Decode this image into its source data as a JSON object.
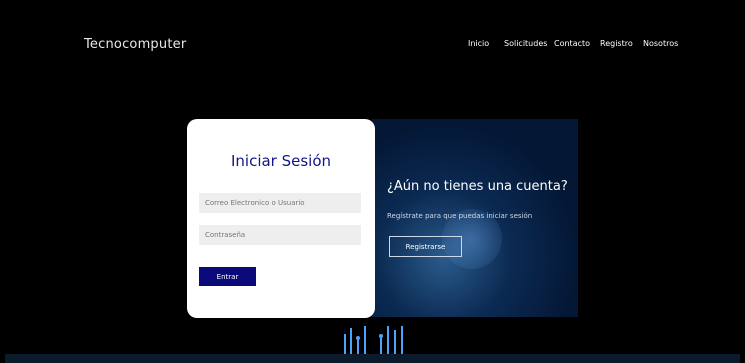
{
  "header": {
    "brand": "Tecnocomputer",
    "nav": [
      "Inicio",
      "Solicitudes",
      "Contacto",
      "Registro",
      "Nosotros"
    ]
  },
  "login": {
    "title": "Iniciar Sesión",
    "email_placeholder": "Correo Electronico o Usuario",
    "password_placeholder": "Contraseña",
    "submit_label": "Entrar"
  },
  "signup": {
    "title": "¿Aún no tienes una cuenta?",
    "text": "Regístrate para que puedas iniciar sesión",
    "button_label": "Registrarse"
  },
  "colors": {
    "accent": "#12148a",
    "button": "#0a0a7a",
    "panel": "#041735"
  },
  "icons": [
    "circuit-graphic"
  ]
}
